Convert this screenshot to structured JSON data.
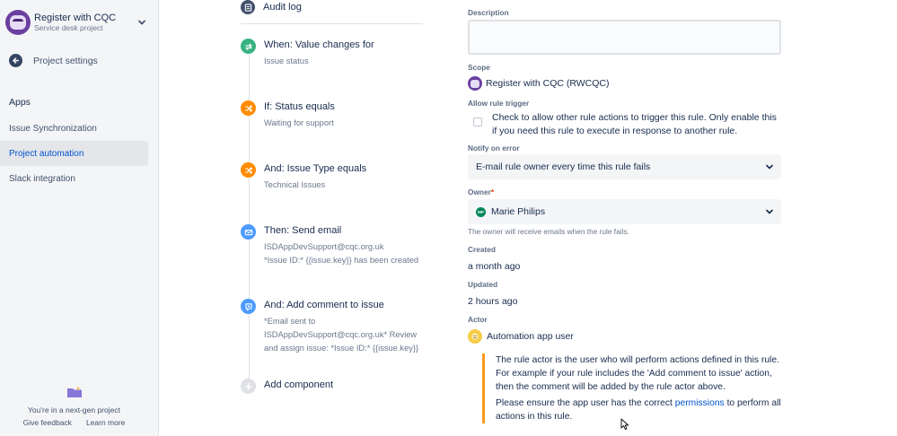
{
  "project": {
    "name": "Register with CQC",
    "type": "Service desk project"
  },
  "sidebar": {
    "back_label": "Project settings",
    "apps_heading": "Apps",
    "items": [
      {
        "label": "Issue Synchronization"
      },
      {
        "label": "Project automation"
      },
      {
        "label": "Slack integration"
      }
    ],
    "nextgen_text": "You're in a next-gen project",
    "feedback_label": "Give feedback",
    "learn_more_label": "Learn more"
  },
  "rule": {
    "audit_label": "Audit log",
    "components": [
      {
        "title": "When: Value changes for",
        "lines": [
          "Issue status"
        ],
        "icon": "trigger-icon",
        "color": "#36b37e"
      },
      {
        "title": "If: Status equals",
        "lines": [
          "Waiting for support"
        ],
        "icon": "condition-icon",
        "color": "#ff8b00"
      },
      {
        "title": "And: Issue Type equals",
        "lines": [
          "Technical Issues"
        ],
        "icon": "condition-icon",
        "color": "#ff8b00"
      },
      {
        "title": "Then: Send email",
        "lines": [
          "ISDAppDevSupport@cqc.org.uk",
          "*Issue ID:* {{issue.key}} has been created"
        ],
        "icon": "email-icon",
        "color": "#4c9aff"
      },
      {
        "title": "And: Add comment to issue",
        "lines": [
          "*Email sent to",
          "ISDAppDevSupport@cqc.org.uk* Review",
          "and assign issue: *Issue ID:* {{issue.key}}"
        ],
        "icon": "comment-icon",
        "color": "#4c9aff"
      }
    ],
    "add_component_label": "Add component"
  },
  "details": {
    "description_label": "Description",
    "description_value": "",
    "scope_label": "Scope",
    "scope_value": "Register with CQC (RWCQC)",
    "allow_trigger_label": "Allow rule trigger",
    "allow_trigger_text": "Check to allow other rule actions to trigger this rule. Only enable this if you need this rule to execute in response to another rule.",
    "allow_trigger_checked": false,
    "notify_label": "Notify on error",
    "notify_value": "E-mail rule owner every time this rule fails",
    "owner_label": "Owner",
    "owner_required": "*",
    "owner_initials": "MP",
    "owner_value": "Marie Philips",
    "owner_helper": "The owner will receive emails when the rule fails.",
    "created_label": "Created",
    "created_value": "a month ago",
    "updated_label": "Updated",
    "updated_value": "2 hours ago",
    "actor_label": "Actor",
    "actor_value": "Automation app user",
    "actor_note_1": "The rule actor is the user who will perform actions defined in this rule. For example if your rule includes the 'Add comment to issue' action, then the comment will be added by the rule actor above.",
    "actor_note_2_prefix": "Please ensure the app user has the correct ",
    "actor_note_2_link": "permissions",
    "actor_note_2_suffix": " to perform all actions in this rule."
  },
  "colors": {
    "accent": "#0052cc",
    "warning_border": "#ff991f",
    "owner_avatar": "#00875a"
  }
}
